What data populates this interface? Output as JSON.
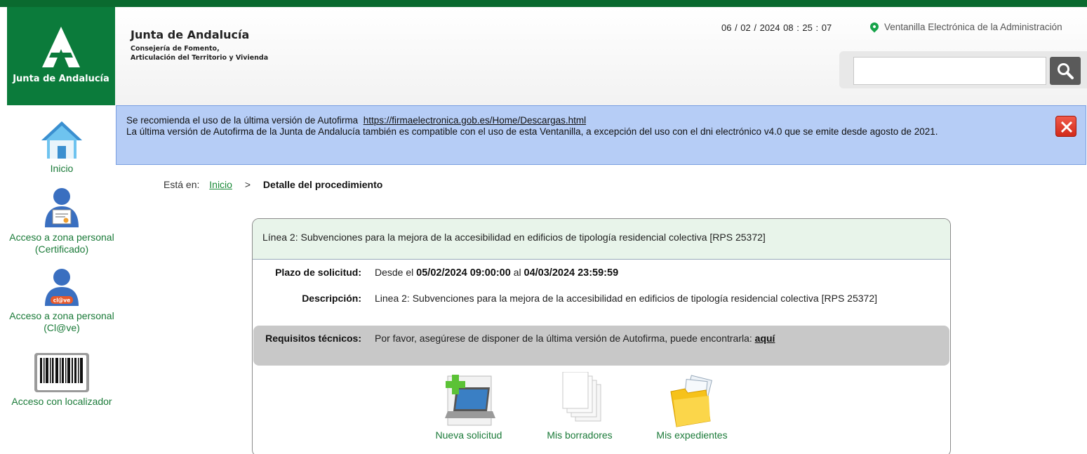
{
  "header": {
    "logo_text": "Junta de Andalucía",
    "org_name": "Junta de Andalucía",
    "org_dept": "Consejería de Fomento,\nArticulación del Territorio y Vivienda",
    "datetime": "06 / 02 / 2024   08 : 25 : 07",
    "ventanilla": "Ventanilla Electrónica de la Administración",
    "search_value": "",
    "accent_color": "#0b7b3b"
  },
  "notice": {
    "line1": "Se recomienda el uso de la última versión de Autofirma",
    "link": "https://firmaelectronica.gob.es/Home/Descargas.html",
    "line2": "La última versión de Autofirma de la Junta de Andalucía también es compatible con el uso de esta Ventanilla, a excepción del uso con el dni electrónico v4.0 que se emite desde agosto de 2021.",
    "close_icon": "close-icon"
  },
  "sidebar": {
    "items": [
      {
        "label": "Inicio",
        "icon": "home-icon"
      },
      {
        "label": "Acceso a zona personal (Certificado)",
        "icon": "certificate-user-icon"
      },
      {
        "label": "Acceso a zona personal (Cl@ve)",
        "icon": "clave-user-icon"
      },
      {
        "label": "Acceso con localizador",
        "icon": "barcode-icon"
      }
    ]
  },
  "breadcrumb": {
    "prefix": "Está en:",
    "home": "Inicio",
    "separator": ">",
    "current": "Detalle del procedimiento"
  },
  "procedure": {
    "title": "Línea 2: Subvenciones para la mejora de la accesibilidad en edificios de tipología residencial colectiva [RPS 25372]",
    "plazo_label": "Plazo de solicitud:",
    "plazo_desde": "Desde el",
    "plazo_start": "05/02/2024 09:00:00",
    "plazo_al": "al",
    "plazo_end": "04/03/2024 23:59:59",
    "desc_label": "Descripción:",
    "desc_value": "Linea 2: Subvenciones para la mejora de la accesibilidad en edificios de tipología residencial colectiva [RPS 25372]",
    "req_label": "Requisitos técnicos:",
    "req_value": "Por favor, asegúrese de disponer de la última versión de Autofirma, puede encontrarla:",
    "req_link": "aquí"
  },
  "actions": [
    {
      "label": "Nueva solicitud",
      "icon": "new-request-icon"
    },
    {
      "label": "Mis borradores",
      "icon": "drafts-icon"
    },
    {
      "label": "Mis expedientes",
      "icon": "folder-icon"
    }
  ]
}
